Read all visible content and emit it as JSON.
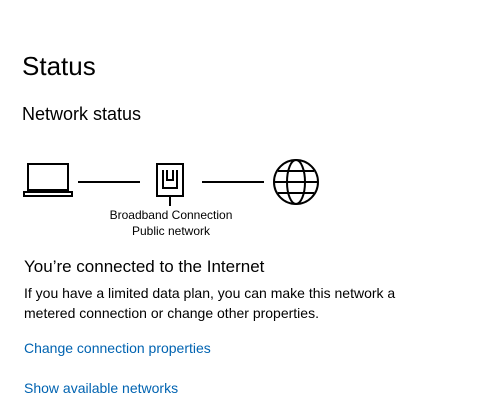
{
  "page": {
    "title": "Status"
  },
  "network_status": {
    "heading": "Network status",
    "diagram": {
      "device_icon": "laptop-icon",
      "router_icon": "router-icon",
      "internet_icon": "globe-icon",
      "connection_name": "Broadband Connection",
      "network_type": "Public network"
    }
  },
  "connection": {
    "heading": "You’re connected to the Internet",
    "description": "If you have a limited data plan, you can make this network a metered connection or change other properties."
  },
  "links": {
    "change_properties": "Change connection properties",
    "show_networks": "Show available networks"
  },
  "colors": {
    "link": "#0063b1",
    "text": "#000000",
    "background": "#ffffff"
  }
}
